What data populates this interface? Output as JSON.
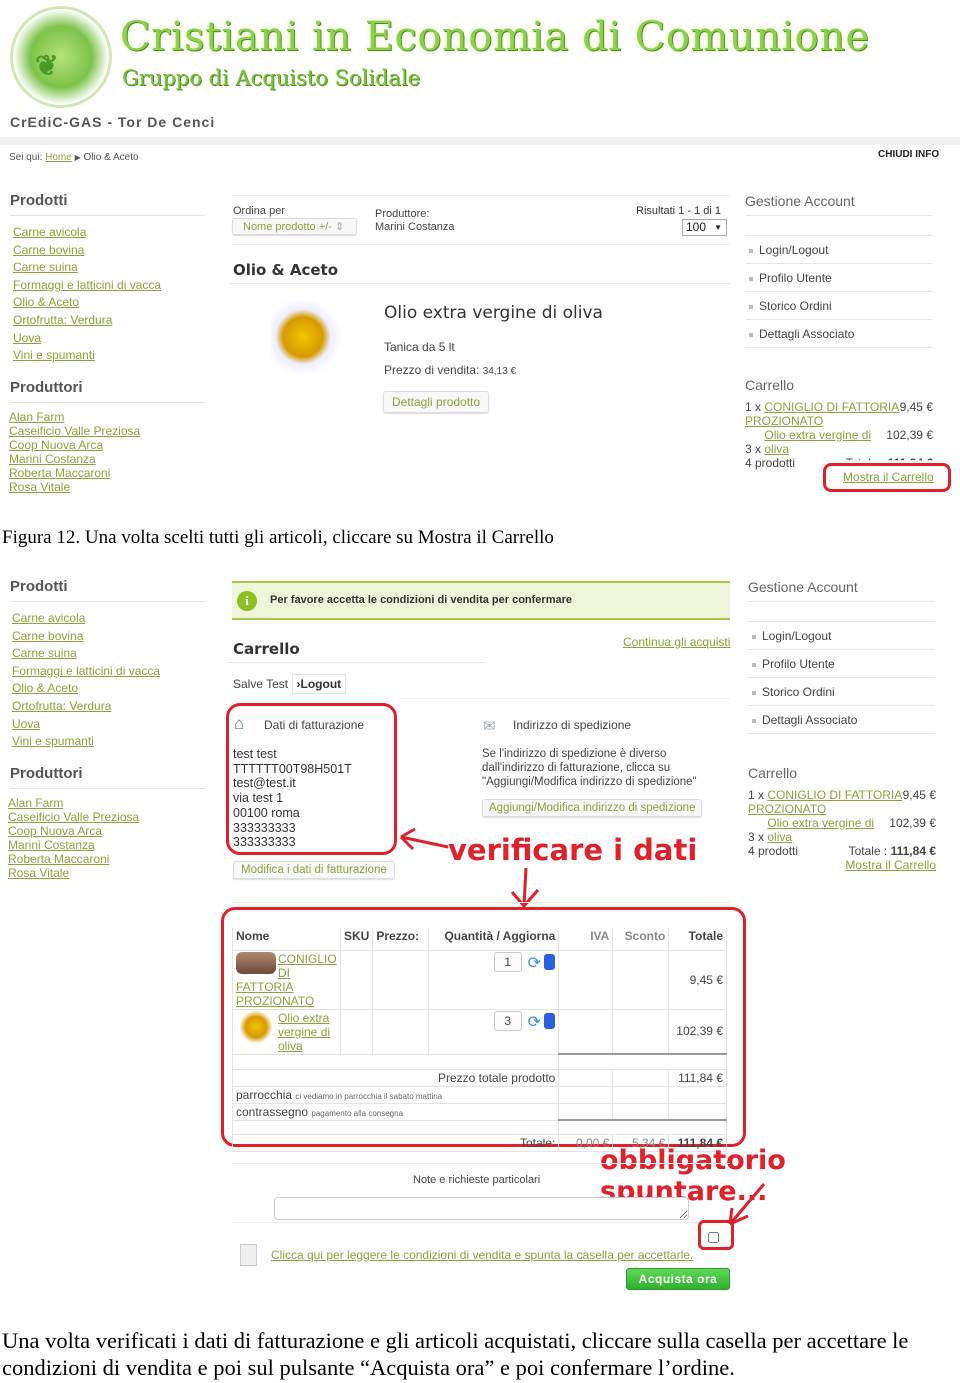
{
  "header": {
    "title": "Cristiani in Economia di Comunione",
    "subtitle": "Gruppo di Acquisto Solidale",
    "site_name": "CrEdiC-GAS - Tor De Cenci",
    "logo_text": "CrEdiC-GAS - Tor de Cenci"
  },
  "breadcrumb": {
    "prefix": "Sei qui:",
    "home": "Home",
    "current": "Olio & Aceto",
    "close_info": "CHIUDI INFO"
  },
  "sidebar": {
    "products_title": "Prodotti",
    "products": [
      "Carne avicola",
      "Carne bovina",
      "Carne suina",
      "Formaggi e latticini di vacca",
      "Olio & Aceto",
      "Ortofrutta: Verdura",
      "Uova",
      "Vini e spumanti"
    ],
    "producers_title": "Produttori",
    "producers": [
      "Alan Farm",
      "Caseificio Valle Preziosa",
      "Coop Nuova Arca",
      "Marini Costanza",
      "Roberta Maccaroni",
      "Rosa Vitale"
    ]
  },
  "account": {
    "title": "Gestione Account",
    "items": [
      "Login/Logout",
      "Profilo Utente",
      "Storico Ordini",
      "Dettagli Associato"
    ]
  },
  "mini_cart": {
    "title": "Carrello",
    "items": [
      {
        "qty": "1 x",
        "name": "CONIGLIO DI FATTORIA PROZIONATO",
        "price": "9,45 €"
      },
      {
        "qty": "3 x",
        "name": "Olio extra vergine di oliva",
        "price": "102,39 €"
      }
    ],
    "count": "4 prodotti",
    "total_label": "Totale :",
    "total": "111,84 €",
    "show_cart": "Mostra il Carrello"
  },
  "shot1": {
    "sort_label": "Ordina per",
    "sort_value": "Nome prodotto +/-",
    "producer_label": "Produttore:",
    "producer_value": "Marini Costanza",
    "results": "Risultati 1 - 1 di 1",
    "per_page": "100",
    "category_title": "Olio & Aceto",
    "product_name": "Olio extra vergine di oliva",
    "product_desc": "Tanica da 5 lt",
    "price_label": "Prezzo di vendita:",
    "price": "34,13 €",
    "details_button": "Dettagli prodotto"
  },
  "caption1": "Figura 12. Una volta scelti tutti gli articoli, cliccare su Mostra il Carrello",
  "shot2": {
    "notice": "Per favore accetta le condizioni di vendita per confermare",
    "cart_title": "Carrello",
    "continue": "Continua gli acquisti",
    "greeting": "Salve Test",
    "logout": "›Logout",
    "billing": {
      "title": "Dati di fatturazione",
      "lines": [
        "test test",
        "TTTTTT00T98H501T",
        "test@test.it",
        "via test 1",
        "00100 roma",
        "333333333",
        "333333333"
      ],
      "edit_button": "Modifica i dati di fatturazione"
    },
    "shipping": {
      "title": "Indirizzo di spedizione",
      "text": "Se l'indirizzo di spedizione è diverso dall'indirizzo di fatturazione, clicca su \"Aggiungi/Modifica indirizzo di spedizione\"",
      "button": "Aggiungi/Modifica indirizzo di spedizione"
    },
    "annotation_verify": "verificare i dati",
    "table": {
      "headers": [
        "Nome",
        "SKU",
        "Prezzo:",
        "Quantità / Aggiorna",
        "IVA",
        "Sconto",
        "Totale"
      ],
      "rows": [
        {
          "name": "CONIGLIO DI FATTORIA PROZIONATO",
          "qty": "1",
          "total": "9,45 €"
        },
        {
          "name": "Olio extra vergine di oliva",
          "qty": "3",
          "total": "102,39 €"
        }
      ],
      "subtotal_label": "Prezzo totale prodotto",
      "subtotal": "111,84 €",
      "shipping_method": "parrocchia",
      "shipping_note": "ci vediamo in parrocchia il sabato mattina",
      "payment_method": "contrassegno",
      "payment_note": "pagamento alla consegna",
      "total_label": "Totale:",
      "total_iva": "0,00 €",
      "total_discount": "5,34 €",
      "total": "111,84 €"
    },
    "notes_label": "Note e richieste particolari",
    "notes_value": "",
    "annotation_check": "obbligatorio spuntare...",
    "terms_link": "Clicca qui per leggere le condizioni di vendita e spunta la casella per accettarle.",
    "terms_checked": false,
    "buy_button": "Acquista ora"
  },
  "paragraph": "Una volta verificati i dati di fatturazione e gli articoli acquistati, cliccare sulla casella per accettare le condizioni di vendita e poi sul pulsante “Acquista ora” e poi confermare l’ordine.",
  "colors": {
    "link": "#8aa43b",
    "annotation": "#e0202a",
    "buy_button": "#3cbf3a",
    "notice_bg": "#eef5d8"
  }
}
